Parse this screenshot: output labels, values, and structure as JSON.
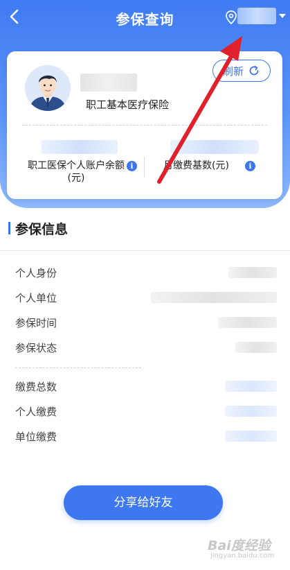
{
  "header": {
    "title": "参保查询",
    "back_icon": "chevron-left-icon",
    "location_icon": "location-pin-icon"
  },
  "card": {
    "insurance_type": "职工基本医疗保险",
    "refresh_label": "刷新",
    "stat_left_label": "职工医保个人账户余额(元)",
    "stat_right_label": "月缴费基数(元)",
    "info_glyph": "i"
  },
  "section": {
    "title": "参保信息",
    "rows_a": [
      {
        "label": "个人身份"
      },
      {
        "label": "个人单位"
      },
      {
        "label": "参保时间"
      },
      {
        "label": "参保状态"
      }
    ],
    "rows_b": [
      {
        "label": "缴费总数"
      },
      {
        "label": "个人缴费"
      },
      {
        "label": "单位缴费"
      }
    ]
  },
  "share_button": "分享给好友",
  "watermark": {
    "main": "Bai度经验",
    "sub": "jingyan.baidu.com"
  },
  "colors": {
    "accent": "#3b75ef",
    "annotation_arrow": "#e0212b"
  }
}
